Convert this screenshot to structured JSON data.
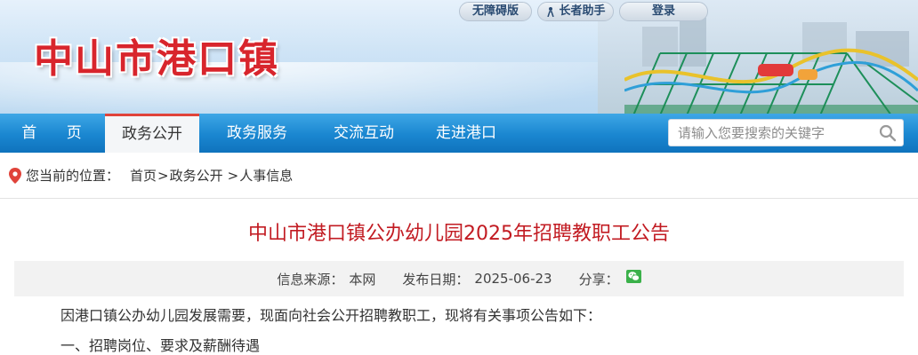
{
  "header": {
    "site_title": "中山市港口镇",
    "top_links": {
      "accessible": "无障碍版",
      "elder": "长者助手",
      "login": "登录"
    }
  },
  "nav": {
    "items": [
      {
        "label": "首 页"
      },
      {
        "label": "政务公开",
        "active": true
      },
      {
        "label": "政务服务"
      },
      {
        "label": "交流互动"
      },
      {
        "label": "走进港口"
      }
    ],
    "search_placeholder": "请输入您要搜索的关键字"
  },
  "breadcrumb": {
    "location_label": "您当前的位置：",
    "items": [
      "首页",
      "政务公开",
      "人事信息"
    ],
    "separator": ">"
  },
  "article": {
    "title": "中山市港口镇公办幼儿园2025年招聘教职工公告",
    "meta": {
      "source_label": "信息来源：",
      "source_value": "本网",
      "date_label": "发布日期：",
      "date_value": "2025-06-23",
      "share_label": "分享："
    },
    "paragraphs": [
      "因港口镇公办幼儿园发展需要，现面向社会公开招聘教职工，现将有关事项公告如下：",
      "一、招聘岗位、要求及薪酬待遇"
    ]
  },
  "colors": {
    "title_red": "#d8252c",
    "nav_blue": "#1a86d0",
    "article_title_red": "#c21b22",
    "active_tab_border": "#e0433a",
    "wechat_green": "#3bb14a"
  },
  "icons": [
    "accessibility-icon",
    "elder-helper-icon",
    "search-icon",
    "location-pin-icon",
    "wechat-icon"
  ]
}
